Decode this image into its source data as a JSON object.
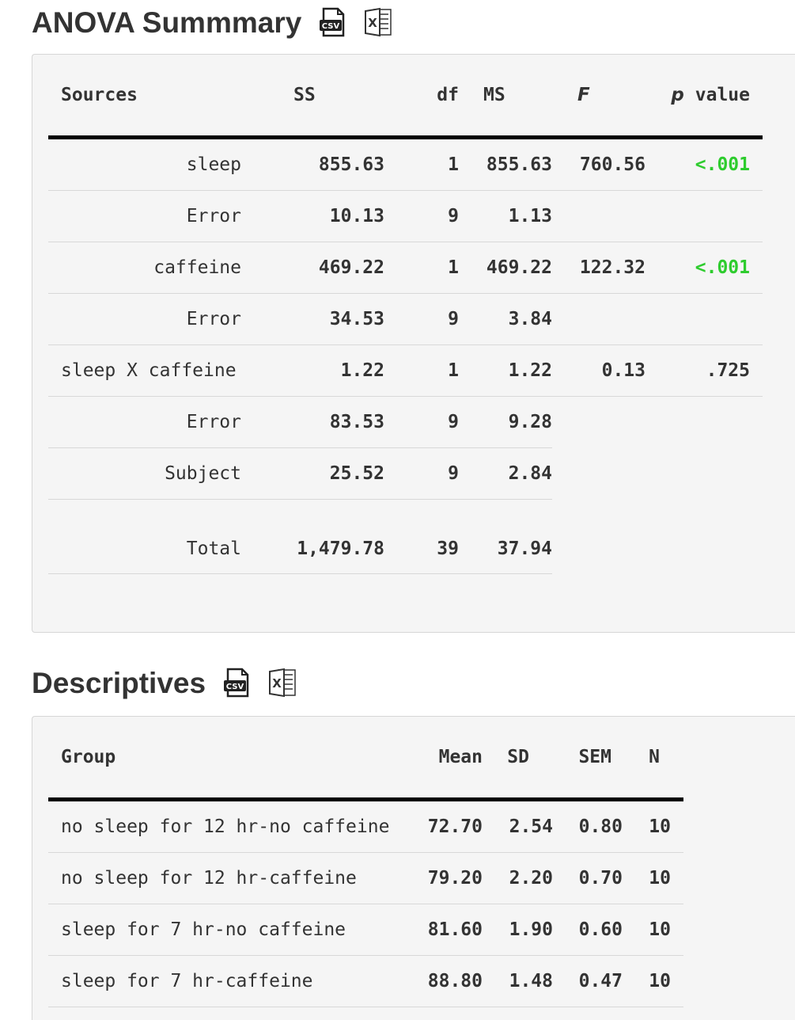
{
  "anova": {
    "title": "ANOVA Summmary",
    "headers": [
      "Sources",
      "SS",
      "df",
      "MS",
      "F",
      "p",
      "value"
    ],
    "rows": [
      {
        "source": "sleep",
        "ss": "855.63",
        "df": "1",
        "ms": "855.63",
        "f": "760.56",
        "p": "<.001",
        "sig": true
      },
      {
        "source": "Error",
        "ss": "10.13",
        "df": "9",
        "ms": "1.13",
        "f": "",
        "p": "",
        "sig": false
      },
      {
        "source": "caffeine",
        "ss": "469.22",
        "df": "1",
        "ms": "469.22",
        "f": "122.32",
        "p": "<.001",
        "sig": true
      },
      {
        "source": "Error",
        "ss": "34.53",
        "df": "9",
        "ms": "3.84",
        "f": "",
        "p": "",
        "sig": false
      },
      {
        "source": "sleep X caffeine",
        "ss": "1.22",
        "df": "1",
        "ms": "1.22",
        "f": "0.13",
        "p": ".725",
        "sig": false
      },
      {
        "source": "Error",
        "ss": "83.53",
        "df": "9",
        "ms": "9.28",
        "f": "",
        "p": "",
        "sig": false
      },
      {
        "source": "Subject",
        "ss": "25.52",
        "df": "9",
        "ms": "2.84",
        "f": "",
        "p": "",
        "sig": false
      }
    ],
    "total": {
      "source": "Total",
      "ss": "1,479.78",
      "df": "39",
      "ms": "37.94"
    }
  },
  "descriptives": {
    "title": "Descriptives",
    "headers": [
      "Group",
      "Mean",
      "SD",
      "SEM",
      "N"
    ],
    "rows": [
      {
        "group": "no sleep for 12 hr-no caffeine",
        "mean": "72.70",
        "sd": "2.54",
        "sem": "0.80",
        "n": "10"
      },
      {
        "group": "no sleep for 12 hr-caffeine",
        "mean": "79.20",
        "sd": "2.20",
        "sem": "0.70",
        "n": "10"
      },
      {
        "group": "sleep for 7 hr-no caffeine",
        "mean": "81.60",
        "sd": "1.90",
        "sem": "0.60",
        "n": "10"
      },
      {
        "group": "sleep for 7 hr-caffeine",
        "mean": "88.80",
        "sd": "1.48",
        "sem": "0.47",
        "n": "10"
      }
    ]
  },
  "icons": {
    "csv": "csv-download-icon",
    "excel": "excel-download-icon"
  },
  "colors": {
    "significant": "#2ecc2e",
    "panel_bg": "#f5f5f5"
  }
}
